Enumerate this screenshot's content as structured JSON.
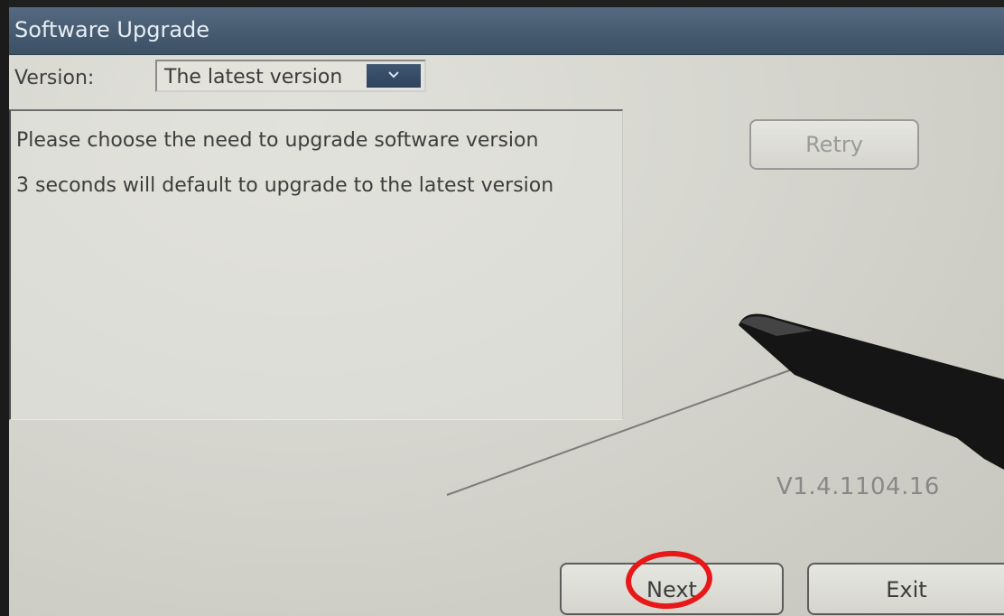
{
  "window": {
    "title": "Software Upgrade"
  },
  "version_selector": {
    "label": "Version:",
    "selected": "The latest version"
  },
  "messages": [
    "Please choose the need to upgrade software version",
    "3 seconds will default to upgrade to the latest version"
  ],
  "buttons": {
    "retry": "Retry",
    "next": "Next",
    "exit": "Exit"
  },
  "firmware_version": "V1.4.1104.16",
  "colors": {
    "title_bar": "#465b70",
    "highlight": "#e81818"
  },
  "icons": {
    "dropdown": "chevron-down-icon"
  }
}
